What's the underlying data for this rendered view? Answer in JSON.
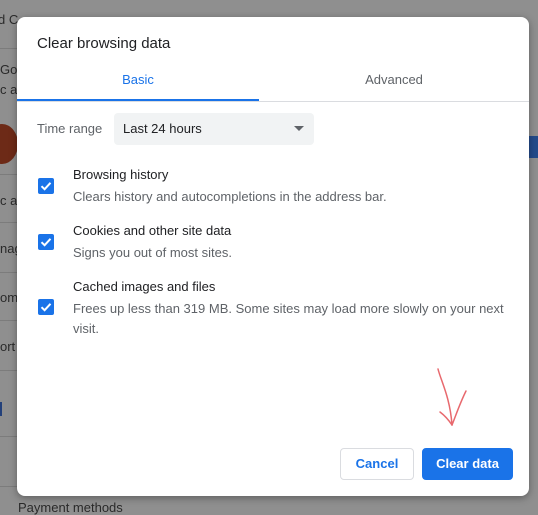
{
  "background": {
    "fragments": [
      "d C",
      "Goo",
      "c a",
      "c an",
      "nag",
      "ome",
      "ort",
      "Payment methods"
    ]
  },
  "dialog": {
    "title": "Clear browsing data",
    "tabs": [
      {
        "label": "Basic",
        "selected": true
      },
      {
        "label": "Advanced",
        "selected": false
      }
    ],
    "time_range": {
      "label": "Time range",
      "selected": "Last 24 hours"
    },
    "options": [
      {
        "title": "Browsing history",
        "description": "Clears history and autocompletions in the address bar.",
        "checked": true
      },
      {
        "title": "Cookies and other site data",
        "description": "Signs you out of most sites.",
        "checked": true
      },
      {
        "title": "Cached images and files",
        "description": "Frees up less than 319 MB. Some sites may load more slowly on your next visit.",
        "checked": true
      }
    ],
    "buttons": {
      "cancel_label": "Cancel",
      "clear_label": "Clear data"
    }
  },
  "colors": {
    "accent": "#1a73e8",
    "annotation_arrow": "#e8696e"
  }
}
